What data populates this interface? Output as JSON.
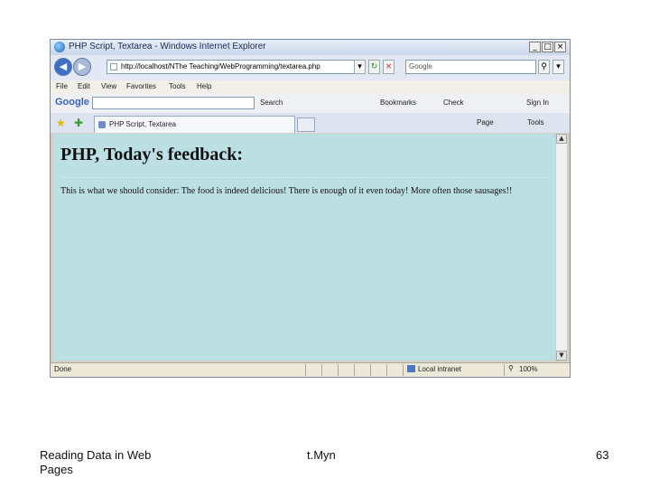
{
  "window": {
    "title": "PHP Script, Textarea - Windows Internet Explorer",
    "min_label": "_",
    "max_label": "□",
    "close_label": "×"
  },
  "address": {
    "back_label": "◀",
    "forward_label": "▶",
    "url": "http://localhost/NThe Teaching/WebProgramming/textarea.php",
    "search_value": "Google"
  },
  "menu": [
    "File",
    "Edit",
    "View",
    "Favorites",
    "Tools",
    "Help"
  ],
  "googlebar": {
    "logo": "Google",
    "search_label": "Search",
    "bookmarks_label": "Bookmarks",
    "check_label": "Check",
    "signin_label": "Sign In"
  },
  "tabs": {
    "active_label": "PHP Script, Textarea",
    "page_label": "Page",
    "tools_label": "Tools"
  },
  "page": {
    "heading": "PHP, Today's feedback:",
    "text": "This is what we should consider: The food is indeed delicious! There is enough of it even today! More often those sausages!!"
  },
  "status": {
    "left": "Done",
    "zone": "Local intranet",
    "zoom": "100%"
  },
  "footer": {
    "left": "Reading Data in Web Pages",
    "center": "t.Myn",
    "page_number": "63"
  },
  "colors": {
    "content_bg": "#bbdfe3",
    "window_frame": "#d4d0c8"
  }
}
